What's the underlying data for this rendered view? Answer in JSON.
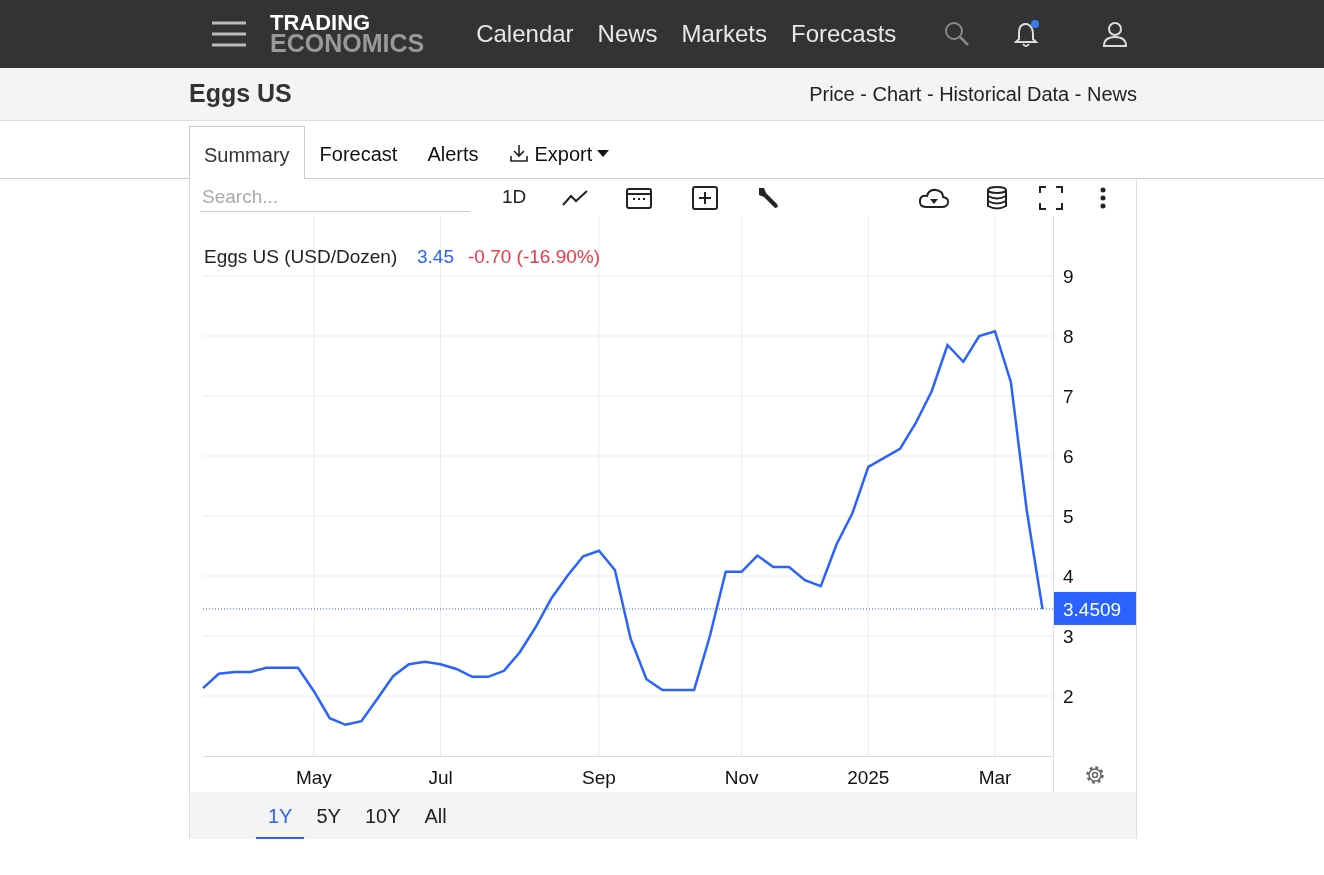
{
  "logo": {
    "line_1": "TRADING",
    "line_2": "ECONOMICS"
  },
  "nav": [
    "Calendar",
    "News",
    "Markets",
    "Forecasts"
  ],
  "notifications": {
    "unread": true
  },
  "page": {
    "title": "Eggs US",
    "links": "Price - Chart - Historical Data - News"
  },
  "tabs": [
    {
      "label": "Summary",
      "selected": true,
      "kind": "tab"
    },
    {
      "label": "Forecast",
      "selected": false,
      "kind": "tab"
    },
    {
      "label": "Alerts",
      "selected": false,
      "kind": "tab"
    },
    {
      "label": "Export",
      "selected": false,
      "kind": "dropdown"
    }
  ],
  "toolbar": {
    "search": {
      "placeholder": "Search..."
    },
    "interval": "1D"
  },
  "chart": {
    "legend": {
      "last": "3.45",
      "change": "-0.70 (-16.90%)"
    },
    "chart_data": {
      "type": "line",
      "title": "Eggs US (USD/Dozen)",
      "grid": true,
      "ref_lines": [
        {
          "axis": "y",
          "value": 3.4509,
          "label": "3.4509",
          "color": "#2962ff"
        }
      ],
      "categories": [
        null,
        null,
        null,
        null,
        null,
        null,
        null,
        "May",
        null,
        null,
        null,
        null,
        null,
        null,
        null,
        "Jul",
        null,
        null,
        null,
        null,
        null,
        null,
        null,
        null,
        null,
        "Sep",
        null,
        null,
        null,
        null,
        null,
        null,
        null,
        null,
        "Nov",
        null,
        null,
        null,
        null,
        null,
        null,
        null,
        "2025",
        null,
        null,
        null,
        null,
        null,
        null,
        null,
        "Mar",
        null,
        null,
        null
      ],
      "series": [
        {
          "color": "#2962ff",
          "values": [
            2.13,
            2.37,
            2.4,
            2.4,
            2.47,
            2.47,
            2.47,
            2.08,
            1.63,
            1.52,
            1.58,
            1.95,
            2.33,
            2.53,
            2.57,
            2.53,
            2.45,
            2.32,
            2.32,
            2.42,
            2.73,
            3.15,
            3.63,
            4.0,
            4.33,
            4.42,
            4.1,
            2.95,
            2.28,
            2.1,
            2.1,
            2.1,
            3.0,
            4.07,
            4.07,
            4.34,
            4.15,
            4.15,
            3.93,
            3.83,
            4.53,
            5.05,
            5.82,
            5.97,
            6.12,
            6.55,
            7.08,
            7.85,
            7.57,
            8.0,
            8.08,
            7.23,
            5.1,
            3.45
          ]
        }
      ],
      "ylim": [
        1,
        10
      ],
      "yticks": [
        2,
        3,
        4,
        5,
        6,
        7,
        8,
        9
      ]
    }
  },
  "ranges": [
    {
      "label": "1Y",
      "selected": true
    },
    {
      "label": "5Y",
      "selected": false
    },
    {
      "label": "10Y",
      "selected": false
    },
    {
      "label": "All",
      "selected": false
    }
  ]
}
